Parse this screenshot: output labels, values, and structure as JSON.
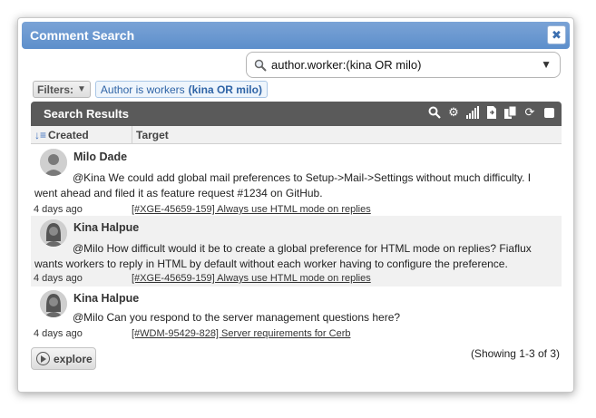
{
  "dialog": {
    "title": "Comment Search",
    "close_label": "✖"
  },
  "search": {
    "query": "author.worker:(kina OR milo)"
  },
  "filters": {
    "button_label": "Filters:",
    "chip_prefix": "Author is workers",
    "chip_value": "(kina OR milo)"
  },
  "results": {
    "title": "Search Results",
    "toolbar_icons": [
      "search-icon",
      "gear-icon",
      "signal-bars-icon",
      "document-export-icon",
      "copy-icon",
      "refresh-icon",
      "select-all-checkbox"
    ],
    "columns": {
      "created": "Created",
      "target": "Target"
    },
    "rows": [
      {
        "author": "Milo Dade",
        "comment_line1": "@Kina We could add global mail preferences to Setup->Mail->Settings without much difficulty. I",
        "comment_line2": "went ahead and filed it as feature request #1234 on GitHub.",
        "created": "4 days ago",
        "target": "[#XGE-45659-159] Always use HTML mode on replies"
      },
      {
        "author": "Kina Halpue",
        "comment_line1": "@Milo How difficult would it be to create a global preference for HTML mode on replies? Fiaflux",
        "comment_line2": "wants workers to reply in HTML by default without each worker having to configure the preference.",
        "created": "4 days ago",
        "target": "[#XGE-45659-159] Always use HTML mode on replies"
      },
      {
        "author": "Kina Halpue",
        "comment_line1": "@Milo Can you respond to the server management questions here?",
        "comment_line2": "",
        "created": "4 days ago",
        "target": "[#WDM-95429-828] Server requirements for Cerb"
      }
    ],
    "explore_label": "explore",
    "showing": "(Showing 1-3 of 3)"
  }
}
